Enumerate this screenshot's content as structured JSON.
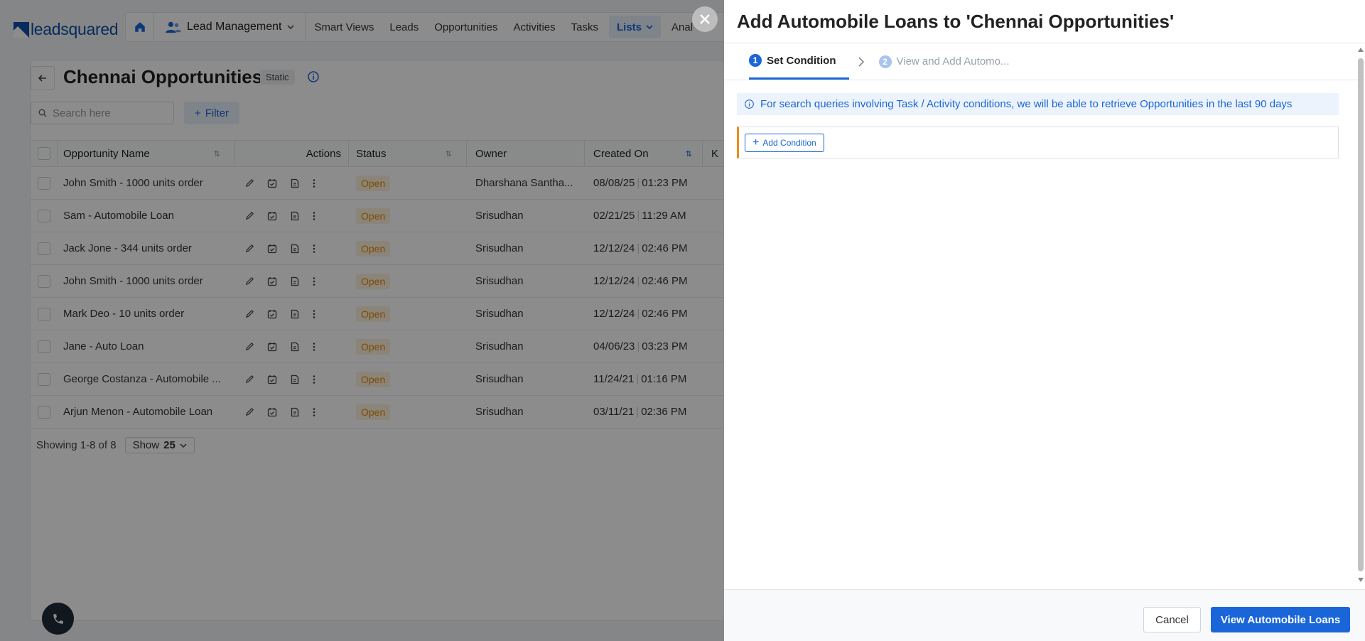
{
  "app": {
    "logo_text": "leadsquared",
    "nav": {
      "module": "Lead Management",
      "items": [
        "Smart Views",
        "Leads",
        "Opportunities",
        "Activities",
        "Tasks"
      ],
      "active_item": "Lists",
      "truncated_item": "Anal"
    },
    "page": {
      "title": "Chennai Opportunities",
      "badge": "Static",
      "search_placeholder": "Search here",
      "filter_label": "Filter"
    },
    "table": {
      "headers": {
        "name": "Opportunity Name",
        "actions": "Actions",
        "status": "Status",
        "owner": "Owner",
        "created": "Created On",
        "k": "K"
      },
      "rows": [
        {
          "name": "John Smith - 1000 units order",
          "status": "Open",
          "owner": "Dharshana Santha...",
          "date": "08/08/25",
          "time": "01:23 PM"
        },
        {
          "name": "Sam - Automobile Loan",
          "status": "Open",
          "owner": "Srisudhan",
          "date": "02/21/25",
          "time": "11:29 AM"
        },
        {
          "name": "Jack Jone - 344 units order",
          "status": "Open",
          "owner": "Srisudhan",
          "date": "12/12/24",
          "time": "02:46 PM"
        },
        {
          "name": "John Smith - 1000 units order",
          "status": "Open",
          "owner": "Srisudhan",
          "date": "12/12/24",
          "time": "02:46 PM"
        },
        {
          "name": "Mark Deo - 10 units order",
          "status": "Open",
          "owner": "Srisudhan",
          "date": "12/12/24",
          "time": "02:46 PM"
        },
        {
          "name": "Jane - Auto Loan",
          "status": "Open",
          "owner": "Srisudhan",
          "date": "04/06/23",
          "time": "03:23 PM"
        },
        {
          "name": "George Costanza - Automobile ...",
          "status": "Open",
          "owner": "Srisudhan",
          "date": "11/24/21",
          "time": "01:16 PM"
        },
        {
          "name": "Arjun Menon - Automobile Loan",
          "status": "Open",
          "owner": "Srisudhan",
          "date": "03/11/21",
          "time": "02:36 PM"
        }
      ],
      "showing": "Showing 1-8 of 8",
      "show_label": "Show",
      "show_value": "25"
    }
  },
  "panel": {
    "title": "Add Automobile Loans to 'Chennai Opportunities'",
    "steps": [
      {
        "num": "1",
        "label": "Set Condition",
        "state": "active"
      },
      {
        "num": "2",
        "label": "View and Add Automo...",
        "state": "inactive"
      }
    ],
    "info_text": "For search queries involving Task / Activity conditions, we will be able to retrieve Opportunities in the last 90 days",
    "add_condition_label": "Add Condition",
    "cancel_label": "Cancel",
    "primary_label": "View Automobile Loans"
  },
  "colors": {
    "accent": "#1a66d8",
    "warning_border": "#f08c1a",
    "status_open": "#e68a00"
  }
}
